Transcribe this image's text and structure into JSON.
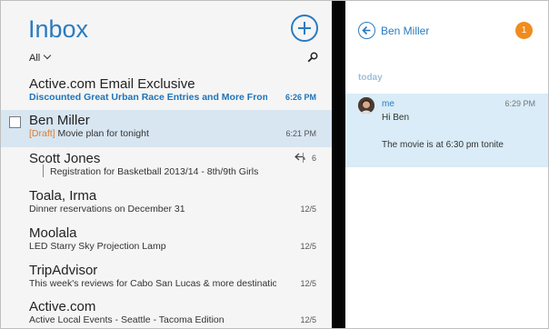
{
  "inbox": {
    "title": "Inbox",
    "filter_label": "All",
    "messages": [
      {
        "sender": "Active.com Email Exclusive",
        "subject": "Discounted Great Urban Race Entries and More From T...",
        "time": "6:26 PM"
      },
      {
        "sender": "Ben Miller",
        "draft_tag": "[Draft]",
        "subject": "Movie plan for tonight",
        "time": "6:21 PM"
      },
      {
        "sender": "Scott Jones",
        "subject": "Registration for Basketball 2013/14 - 8th/9th Girls",
        "thread_count": "6"
      },
      {
        "sender": "Toala, Irma",
        "subject": "Dinner reservations on December 31",
        "time": "12/5"
      },
      {
        "sender": "Moolala",
        "subject": "LED Starry Sky Projection Lamp",
        "time": "12/5"
      },
      {
        "sender": "TripAdvisor",
        "subject": "This week's reviews for Cabo San Lucas & more destinatio...",
        "time": "12/5"
      },
      {
        "sender": "Active.com",
        "subject": "Active Local Events - Seattle - Tacoma Edition",
        "time": "12/5"
      }
    ]
  },
  "conversation": {
    "contact_name": "Ben Miller",
    "badge_count": "1",
    "section_label": "today",
    "message": {
      "from": "me",
      "time": "6:29 PM",
      "line1": "Hi Ben",
      "line2": "The movie is at 6:30 pm tonite"
    }
  },
  "colors": {
    "accent": "#2b7bc0",
    "selected_row": "#d8e6f2",
    "message_bubble": "#d9ecf7",
    "badge": "#f08c1f",
    "draft": "#e07b2b"
  },
  "icons": [
    "compose-icon",
    "chevron-down-icon",
    "search-icon",
    "reply-icon",
    "back-arrow-icon"
  ]
}
